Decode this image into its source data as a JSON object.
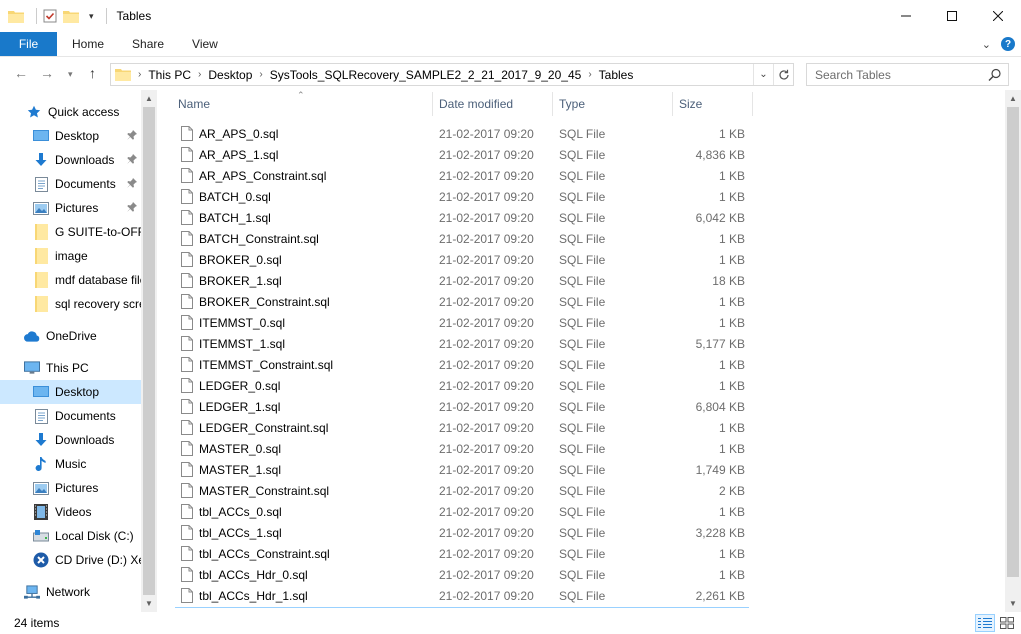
{
  "window": {
    "title": "Tables"
  },
  "ribbon": {
    "file": "File",
    "tabs": [
      "Home",
      "Share",
      "View"
    ]
  },
  "address": {
    "crumbs": [
      "This PC",
      "Desktop",
      "SysTools_SQLRecovery_SAMPLE2_2_21_2017_9_20_45",
      "Tables"
    ]
  },
  "search": {
    "placeholder": "Search Tables"
  },
  "nav": {
    "quick_access": "Quick access",
    "quick_items": [
      "Desktop",
      "Downloads",
      "Documents",
      "Pictures",
      "G SUITE-to-OFFICE",
      "image",
      "mdf database file",
      "sql recovery screenshots"
    ],
    "onedrive": "OneDrive",
    "this_pc": "This PC",
    "pc_items": [
      "Desktop",
      "Documents",
      "Downloads",
      "Music",
      "Pictures",
      "Videos",
      "Local Disk (C:)",
      "CD Drive (D:) Xe"
    ],
    "network": "Network"
  },
  "columns": {
    "name": "Name",
    "date": "Date modified",
    "type": "Type",
    "size": "Size"
  },
  "files": [
    {
      "name": "AR_APS_0.sql",
      "date": "21-02-2017 09:20",
      "type": "SQL File",
      "size": "1 KB"
    },
    {
      "name": "AR_APS_1.sql",
      "date": "21-02-2017 09:20",
      "type": "SQL File",
      "size": "4,836 KB"
    },
    {
      "name": "AR_APS_Constraint.sql",
      "date": "21-02-2017 09:20",
      "type": "SQL File",
      "size": "1 KB"
    },
    {
      "name": "BATCH_0.sql",
      "date": "21-02-2017 09:20",
      "type": "SQL File",
      "size": "1 KB"
    },
    {
      "name": "BATCH_1.sql",
      "date": "21-02-2017 09:20",
      "type": "SQL File",
      "size": "6,042 KB"
    },
    {
      "name": "BATCH_Constraint.sql",
      "date": "21-02-2017 09:20",
      "type": "SQL File",
      "size": "1 KB"
    },
    {
      "name": "BROKER_0.sql",
      "date": "21-02-2017 09:20",
      "type": "SQL File",
      "size": "1 KB"
    },
    {
      "name": "BROKER_1.sql",
      "date": "21-02-2017 09:20",
      "type": "SQL File",
      "size": "18 KB"
    },
    {
      "name": "BROKER_Constraint.sql",
      "date": "21-02-2017 09:20",
      "type": "SQL File",
      "size": "1 KB"
    },
    {
      "name": "ITEMMST_0.sql",
      "date": "21-02-2017 09:20",
      "type": "SQL File",
      "size": "1 KB"
    },
    {
      "name": "ITEMMST_1.sql",
      "date": "21-02-2017 09:20",
      "type": "SQL File",
      "size": "5,177 KB"
    },
    {
      "name": "ITEMMST_Constraint.sql",
      "date": "21-02-2017 09:20",
      "type": "SQL File",
      "size": "1 KB"
    },
    {
      "name": "LEDGER_0.sql",
      "date": "21-02-2017 09:20",
      "type": "SQL File",
      "size": "1 KB"
    },
    {
      "name": "LEDGER_1.sql",
      "date": "21-02-2017 09:20",
      "type": "SQL File",
      "size": "6,804 KB"
    },
    {
      "name": "LEDGER_Constraint.sql",
      "date": "21-02-2017 09:20",
      "type": "SQL File",
      "size": "1 KB"
    },
    {
      "name": "MASTER_0.sql",
      "date": "21-02-2017 09:20",
      "type": "SQL File",
      "size": "1 KB"
    },
    {
      "name": "MASTER_1.sql",
      "date": "21-02-2017 09:20",
      "type": "SQL File",
      "size": "1,749 KB"
    },
    {
      "name": "MASTER_Constraint.sql",
      "date": "21-02-2017 09:20",
      "type": "SQL File",
      "size": "2 KB"
    },
    {
      "name": "tbl_ACCs_0.sql",
      "date": "21-02-2017 09:20",
      "type": "SQL File",
      "size": "1 KB"
    },
    {
      "name": "tbl_ACCs_1.sql",
      "date": "21-02-2017 09:20",
      "type": "SQL File",
      "size": "3,228 KB"
    },
    {
      "name": "tbl_ACCs_Constraint.sql",
      "date": "21-02-2017 09:20",
      "type": "SQL File",
      "size": "1 KB"
    },
    {
      "name": "tbl_ACCs_Hdr_0.sql",
      "date": "21-02-2017 09:20",
      "type": "SQL File",
      "size": "1 KB"
    },
    {
      "name": "tbl_ACCs_Hdr_1.sql",
      "date": "21-02-2017 09:20",
      "type": "SQL File",
      "size": "2,261 KB"
    }
  ],
  "status": {
    "count": "24 items"
  }
}
